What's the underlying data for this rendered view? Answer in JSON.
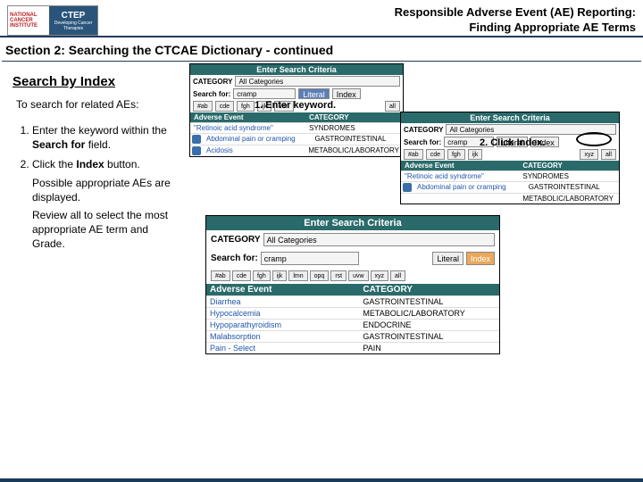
{
  "header": {
    "logo_nci_l1": "NATIONAL",
    "logo_nci_l2": "CANCER",
    "logo_nci_l3": "INSTITUTE",
    "logo_ctep_top": "CTEP",
    "logo_ctep_sub": "Developing Cancer Therapies",
    "title_l1": "Responsible Adverse Event (AE) Reporting:",
    "title_l2": "Finding Appropriate AE Terms"
  },
  "section_title": "Section 2: Searching the CTCAE Dictionary - continued",
  "subhead": "Search by Index",
  "intro": "To search for related AEs:",
  "steps": {
    "s1_a": "Enter the keyword within the ",
    "s1_b": "Search for",
    "s1_c": " field.",
    "s2_a": "Click the ",
    "s2_b": "Index",
    "s2_c": " button.",
    "s2_sub1": "Possible appropriate AEs are displayed.",
    "s2_sub2": "Review all to select the most appropriate AE term and Grade."
  },
  "ui": {
    "esc": "Enter Search Criteria",
    "category": "CATEGORY",
    "all_cat": "All Categories",
    "search_for": "Search for:",
    "keyword": "cramp",
    "literal": "Literal",
    "index": "Index",
    "ae": "Adverse Event",
    "letter_all": "all",
    "letters": [
      "#ab",
      "cde",
      "fgh",
      "ijk",
      "lmn",
      "opq",
      "rst",
      "uvw",
      "xyz"
    ]
  },
  "callouts": {
    "c1": "1. Enter keyword.",
    "c2": "2. Click Index."
  },
  "panel1_rows": [
    {
      "ae": "\"Retinoic acid syndrome\"",
      "cat": "SYNDROMES"
    },
    {
      "ae": "Abdominal pain or cramping",
      "cat": "GASTROINTESTINAL"
    },
    {
      "ae": "Acidosis",
      "cat": "METABOLIC/LABORATORY"
    }
  ],
  "panel2_rows": [
    {
      "ae": "\"Retinoic acid syndrome\"",
      "cat": "SYNDROMES"
    },
    {
      "ae": "Abdominal pain or cramping",
      "cat": "GASTROINTESTINAL"
    },
    {
      "ae": "",
      "cat": "METABOLIC/LABORATORY"
    }
  ],
  "panel3_rows": [
    {
      "ae": "Diarrhea",
      "cat": "GASTROINTESTINAL"
    },
    {
      "ae": "Hypocalcemia",
      "cat": "METABOLIC/LABORATORY"
    },
    {
      "ae": "Hypoparathyroidism",
      "cat": "ENDOCRINE"
    },
    {
      "ae": "Malabsorption",
      "cat": "GASTROINTESTINAL"
    },
    {
      "ae": "Pain - Select",
      "cat": "PAIN"
    }
  ]
}
